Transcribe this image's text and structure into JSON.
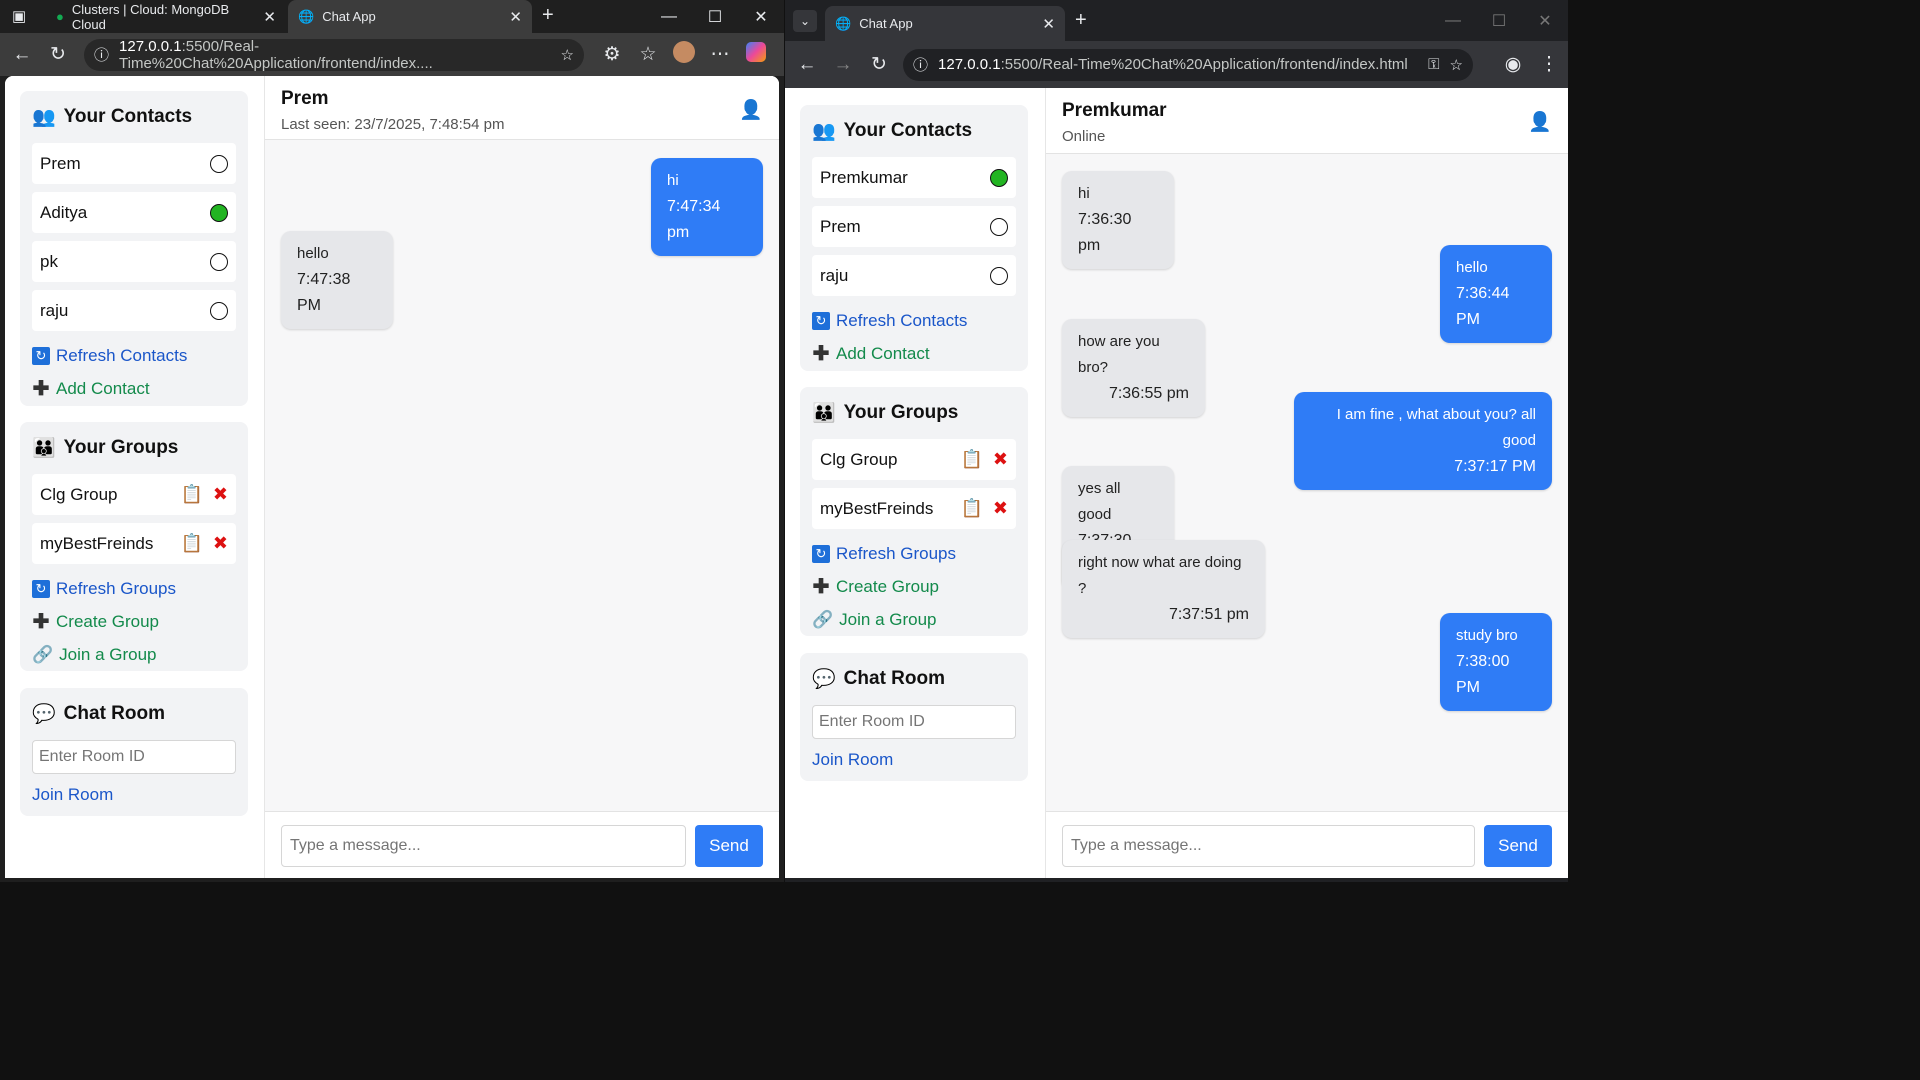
{
  "left": {
    "tabs": [
      {
        "title": "Clusters | Cloud: MongoDB Cloud"
      },
      {
        "title": "Chat App"
      }
    ],
    "address": {
      "host": "127.0.0.1",
      "path": ":5500/Real-Time%20Chat%20Application/frontend/index...."
    },
    "app": {
      "contacts_title": "Your Contacts",
      "contacts": [
        {
          "name": "Prem",
          "online": false
        },
        {
          "name": "Aditya",
          "online": true
        },
        {
          "name": "pk",
          "online": false
        },
        {
          "name": "raju",
          "online": false
        }
      ],
      "refresh_contacts": "Refresh Contacts",
      "add_contact": "Add Contact",
      "groups_title": "Your Groups",
      "groups": [
        {
          "name": "Clg Group"
        },
        {
          "name": "myBestFreinds"
        }
      ],
      "refresh_groups": "Refresh Groups",
      "create_group": "Create Group",
      "join_group": "Join a Group",
      "room_title": "Chat Room",
      "room_placeholder": "Enter Room ID",
      "join_room": "Join Room",
      "chat_name": "Prem",
      "chat_status": "Last seen: 23/7/2025, 7:48:54 pm",
      "messages": [
        {
          "dir": "out",
          "text": "hi",
          "time": "7:47:34 pm"
        },
        {
          "dir": "in",
          "text": "hello",
          "time": "7:47:38 PM"
        }
      ],
      "message_placeholder": "Type a message...",
      "send": "Send"
    }
  },
  "right": {
    "tabs": [
      {
        "title": "Chat App"
      }
    ],
    "address": {
      "host": "127.0.0.1",
      "path": ":5500/Real-Time%20Chat%20Application/frontend/index.html"
    },
    "app": {
      "contacts_title": "Your Contacts",
      "contacts": [
        {
          "name": "Premkumar",
          "online": true
        },
        {
          "name": "Prem",
          "online": false
        },
        {
          "name": "raju",
          "online": false
        }
      ],
      "refresh_contacts": "Refresh Contacts",
      "add_contact": "Add Contact",
      "groups_title": "Your Groups",
      "groups": [
        {
          "name": "Clg Group"
        },
        {
          "name": "myBestFreinds"
        }
      ],
      "refresh_groups": "Refresh Groups",
      "create_group": "Create Group",
      "join_group": "Join a Group",
      "room_title": "Chat Room",
      "room_placeholder": "Enter Room ID",
      "join_room": "Join Room",
      "chat_name": "Premkumar",
      "chat_status": "Online",
      "messages": [
        {
          "dir": "in",
          "text": "hi",
          "time": "7:36:30 pm"
        },
        {
          "dir": "out",
          "text": "hello",
          "time": "7:36:44 PM"
        },
        {
          "dir": "in",
          "text": "how are you bro?",
          "time": "7:36:55 pm"
        },
        {
          "dir": "out",
          "text": "I am fine , what about you? all good",
          "time": "7:37:17 PM"
        },
        {
          "dir": "in",
          "text": "yes all good",
          "time": "7:37:30 pm"
        },
        {
          "dir": "in",
          "text": "right now what are doing ?",
          "time": "7:37:51 pm"
        },
        {
          "dir": "out",
          "text": "study bro",
          "time": "7:38:00 PM"
        }
      ],
      "message_placeholder": "Type a message...",
      "send": "Send"
    }
  },
  "colors": {
    "accent": "#2f7cf6",
    "online": "#22b422",
    "link_blue": "#1a56c9",
    "link_green": "#138a4b"
  }
}
